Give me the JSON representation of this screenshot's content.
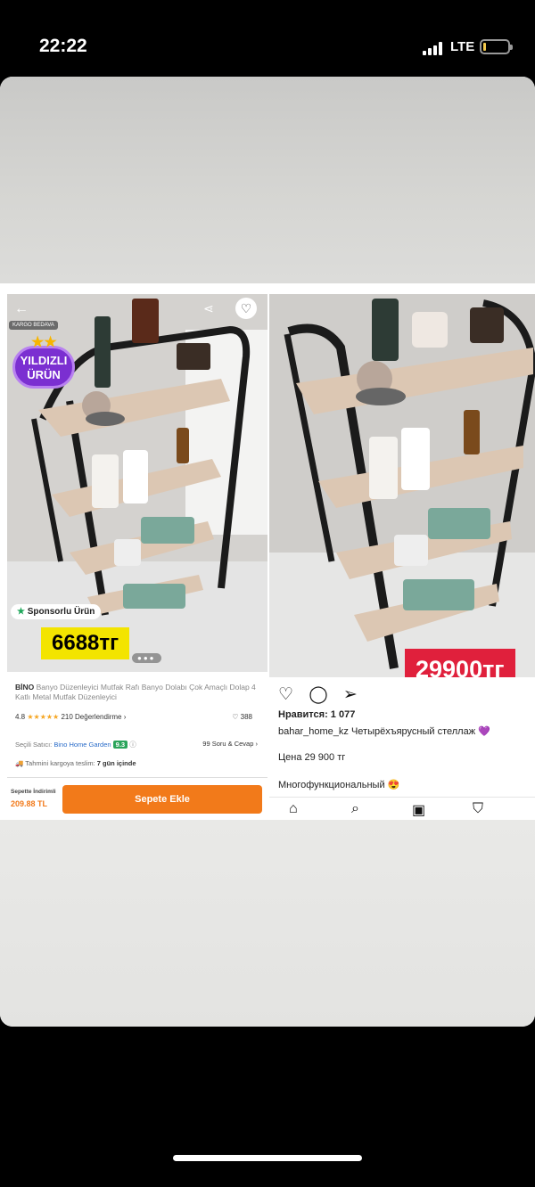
{
  "status_bar": {
    "time": "22:22",
    "network": "LTE"
  },
  "left_listing": {
    "kargo_badge": "KARGO BEDAVA",
    "star_badge": "YILDIZLI ÜRÜN",
    "sponsor_label": "Sponsorlu Ürün",
    "price_overlay": "6688тг",
    "brand": "BİNO",
    "title": "Banyo Düzenleyici Mutfak Rafı Banyo Dolabı Çok Amaçlı Dolap 4 Katlı Metal Mutfak Düzenleyici",
    "rating": "4.8",
    "rating_stars": "★★★★★",
    "reviews": "210 Değerlendirme",
    "likes": "388",
    "seller_prefix": "Seçili Satıcı:",
    "seller_name": "Bino Home Garden",
    "seller_score": "9.3",
    "qa": "99 Soru & Cevap",
    "delivery_prefix": "Tahmini kargoya teslim:",
    "delivery_value": "7 gün içinde",
    "cart_discount_label": "Sepette İndirimli",
    "cart_price": "209.88 TL",
    "add_to_cart": "Sepete Ekle"
  },
  "right_post": {
    "price_overlay": "29900тг",
    "likes": "Нравится: 1 077",
    "username": "bahar_home_kz",
    "caption": "Четырёхъярусный стеллаж 💜",
    "price_line": "Цена 29 900 тг",
    "description": "Многофункциональный 😍"
  },
  "icons": {
    "back": "arrow-left",
    "share": "share",
    "heart": "heart",
    "comment": "comment",
    "send": "send",
    "home": "home",
    "search": "search",
    "reels": "reels",
    "shop": "shop"
  },
  "colors": {
    "trendyol_orange": "#f27a1a",
    "price_yellow": "#f3e400",
    "price_red": "#e0203c",
    "badge_purple": "#7b2fd1"
  }
}
